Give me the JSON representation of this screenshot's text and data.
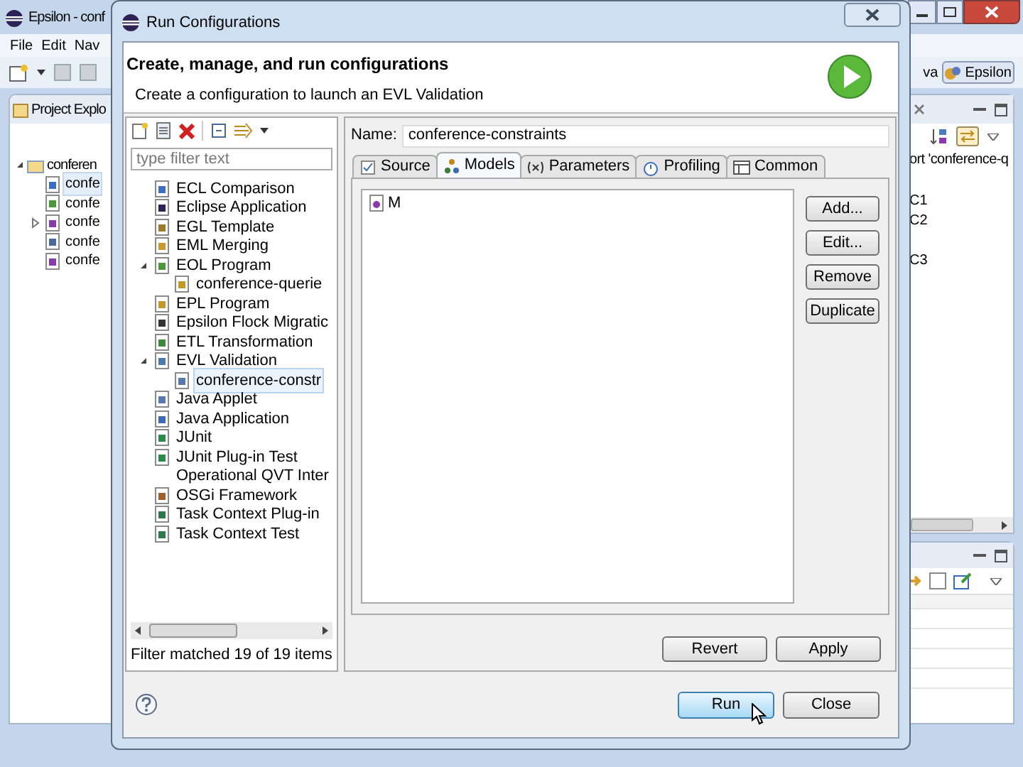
{
  "background_window": {
    "title": "Epsilon - conf",
    "menu": [
      "File",
      "Edit",
      "Nav"
    ],
    "project_explorer": {
      "title": "Project Explo",
      "tree": [
        {
          "label": "conferen",
          "expanded": true,
          "selected": false,
          "children": [
            {
              "label": "confe",
              "selected": true
            },
            {
              "label": "confe",
              "selected": false
            },
            {
              "label": "confe",
              "selected": false,
              "expanded": false
            },
            {
              "label": "confe",
              "selected": false
            },
            {
              "label": "confe",
              "selected": false
            }
          ]
        }
      ]
    },
    "perspectives": [
      {
        "label": "va",
        "selected": false
      },
      {
        "label": "Epsilon",
        "selected": true
      }
    ],
    "outline": {
      "heading": "ort 'conference-q",
      "items": [
        "C1",
        "C2",
        "C3"
      ]
    }
  },
  "dialog": {
    "title": "Run Configurations",
    "header": {
      "title": "Create, manage, and run configurations",
      "message": "Create a configuration to launch an EVL Validation"
    },
    "filter": {
      "placeholder": "type filter text"
    },
    "tree": [
      {
        "label": "ECL Comparison",
        "selected": false
      },
      {
        "label": "Eclipse Application",
        "selected": false
      },
      {
        "label": "EGL Template",
        "selected": false
      },
      {
        "label": "EML Merging",
        "selected": false
      },
      {
        "label": "EOL Program",
        "selected": false,
        "expanded": true,
        "children": [
          {
            "label": "conference-querie",
            "selected": false
          }
        ]
      },
      {
        "label": "EPL Program",
        "selected": false
      },
      {
        "label": "Epsilon Flock Migratic",
        "selected": false
      },
      {
        "label": "ETL Transformation",
        "selected": false
      },
      {
        "label": "EVL Validation",
        "selected": false,
        "expanded": true,
        "children": [
          {
            "label": "conference-constr",
            "selected": true
          }
        ]
      },
      {
        "label": "Java Applet",
        "selected": false
      },
      {
        "label": "Java Application",
        "selected": false
      },
      {
        "label": "JUnit",
        "selected": false
      },
      {
        "label": "JUnit Plug-in Test",
        "selected": false
      },
      {
        "label": "Operational QVT Inter",
        "selected": false,
        "icon": false
      },
      {
        "label": "OSGi Framework",
        "selected": false
      },
      {
        "label": "Task Context Plug-in",
        "selected": false
      },
      {
        "label": "Task Context Test",
        "selected": false
      }
    ],
    "filter_status": "Filter matched 19 of 19 items",
    "name": {
      "label": "Name:",
      "value": "conference-constraints"
    },
    "tabs": [
      {
        "label": "Source",
        "selected": false
      },
      {
        "label": "Models",
        "selected": true
      },
      {
        "label": "Parameters",
        "selected": false
      },
      {
        "label": "Profiling",
        "selected": false
      },
      {
        "label": "Common",
        "selected": false
      }
    ],
    "models": [
      "M"
    ],
    "side_buttons": [
      "Add...",
      "Edit...",
      "Remove",
      "Duplicate"
    ],
    "form_buttons": [
      "Revert",
      "Apply"
    ],
    "buttons": [
      {
        "label": "Run",
        "default": true
      },
      {
        "label": "Close",
        "default": false
      }
    ]
  }
}
